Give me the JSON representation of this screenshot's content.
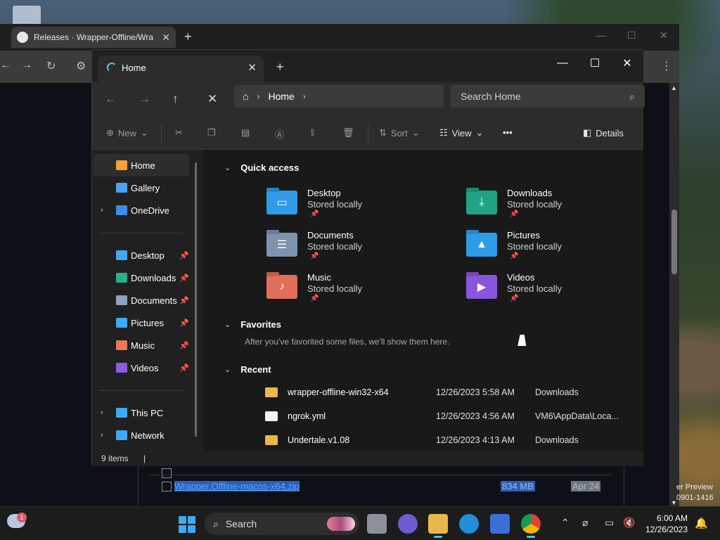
{
  "browser": {
    "tab_title": "Releases · Wrapper-Offline/Wra",
    "new_tab": "+",
    "close_tab": "✕",
    "asset": {
      "name": "Wrapper.Offline-macos-x64.zip",
      "size": "834 MB",
      "date": "Apr 24"
    }
  },
  "watermark": {
    "line1": "er Preview",
    "line2": "0901-1416"
  },
  "explorer": {
    "tab_label": "Home",
    "tab_close": "✕",
    "new_tab": "+",
    "window_controls": {
      "minimize": "—",
      "maximize": "☐",
      "close": "✕"
    },
    "nav": {
      "back": "←",
      "forward": "→",
      "up": "↑",
      "stop": "✕"
    },
    "breadcrumb": {
      "home": "Home"
    },
    "search_placeholder": "Search Home",
    "commands": {
      "new": "New",
      "sort": "Sort",
      "view": "View",
      "more": "•••",
      "details": "Details"
    },
    "sidebar": {
      "top": [
        {
          "label": "Home",
          "icon": "home-icon",
          "color": "#f0a23c"
        },
        {
          "label": "Gallery",
          "icon": "gallery-icon",
          "color": "#4ba3f0"
        },
        {
          "label": "OneDrive",
          "icon": "onedrive-icon",
          "color": "#3a8ee6"
        }
      ],
      "pinned": [
        {
          "label": "Desktop",
          "icon": "desktop-icon",
          "color": "#3fa9f5"
        },
        {
          "label": "Downloads",
          "icon": "downloads-icon",
          "color": "#29b08a"
        },
        {
          "label": "Documents",
          "icon": "documents-icon",
          "color": "#8ea2bd"
        },
        {
          "label": "Pictures",
          "icon": "pictures-icon",
          "color": "#3fa9f5"
        },
        {
          "label": "Music",
          "icon": "music-icon",
          "color": "#e97755"
        },
        {
          "label": "Videos",
          "icon": "videos-icon",
          "color": "#8a5ce0"
        }
      ],
      "bottom": [
        {
          "label": "This PC",
          "icon": "this-pc-icon",
          "color": "#3fa9f5"
        },
        {
          "label": "Network",
          "icon": "network-icon",
          "color": "#3fa9f5"
        }
      ]
    },
    "quick_access": {
      "title": "Quick access",
      "items": [
        {
          "name": "Desktop",
          "sub": "Stored locally",
          "icon": "desktop-folder-icon",
          "color": "#2f9be6",
          "glyph": "▭"
        },
        {
          "name": "Downloads",
          "sub": "Stored locally",
          "icon": "downloads-folder-icon",
          "color": "#1fa383",
          "glyph": "⤓"
        },
        {
          "name": "Documents",
          "sub": "Stored locally",
          "icon": "documents-folder-icon",
          "color": "#7e93ad",
          "glyph": "☰"
        },
        {
          "name": "Pictures",
          "sub": "Stored locally",
          "icon": "pictures-folder-icon",
          "color": "#2f9be6",
          "glyph": "▲"
        },
        {
          "name": "Music",
          "sub": "Stored locally",
          "icon": "music-folder-icon",
          "color": "#e06f57",
          "glyph": "♪"
        },
        {
          "name": "Videos",
          "sub": "Stored locally",
          "icon": "videos-folder-icon",
          "color": "#8a55db",
          "glyph": "▶"
        }
      ]
    },
    "favorites": {
      "title": "Favorites",
      "hint": "After you've favorited some files, we'll show them here."
    },
    "recent": {
      "title": "Recent",
      "rows": [
        {
          "name": "wrapper-offline-win32-x64",
          "date": "12/26/2023 5:58 AM",
          "location": "Downloads",
          "color": "#e8b94a"
        },
        {
          "name": "ngrok.yml",
          "date": "12/26/2023 4:56 AM",
          "location": "VM6\\AppData\\Loca...",
          "color": "#f2f2f2"
        },
        {
          "name": "Undertale.v1.08",
          "date": "12/26/2023 4:13 AM",
          "location": "Downloads",
          "color": "#e8b94a"
        }
      ]
    },
    "status": "9 items",
    "status_sep": "|"
  },
  "taskbar": {
    "badge": "1",
    "search_label": "Search",
    "clock_time": "6:00 AM",
    "clock_date": "12/26/2023"
  }
}
